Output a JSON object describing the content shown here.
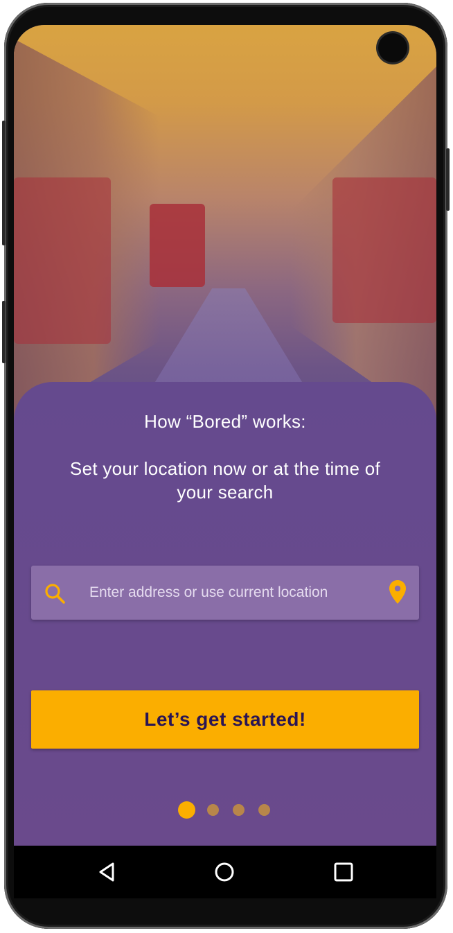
{
  "colors": {
    "panel": "#6a4a8c",
    "accent": "#fbae00",
    "button_text": "#2a1554",
    "search_bg": "#8a6ea8",
    "dot_active": "#fbae00",
    "dot_inactive": "#b8864a"
  },
  "onboarding": {
    "heading": "How “Bored” works:",
    "description": "Set your location now or at the time of your search",
    "search": {
      "placeholder": "Enter address or use current location",
      "value": "",
      "left_icon": "search-icon",
      "right_icon": "location-pin-icon"
    },
    "cta_label": "Let’s get started!",
    "pagination": {
      "total": 4,
      "active": 1
    }
  },
  "nav_bar": {
    "buttons": [
      "back-icon",
      "home-icon",
      "recents-icon"
    ]
  }
}
